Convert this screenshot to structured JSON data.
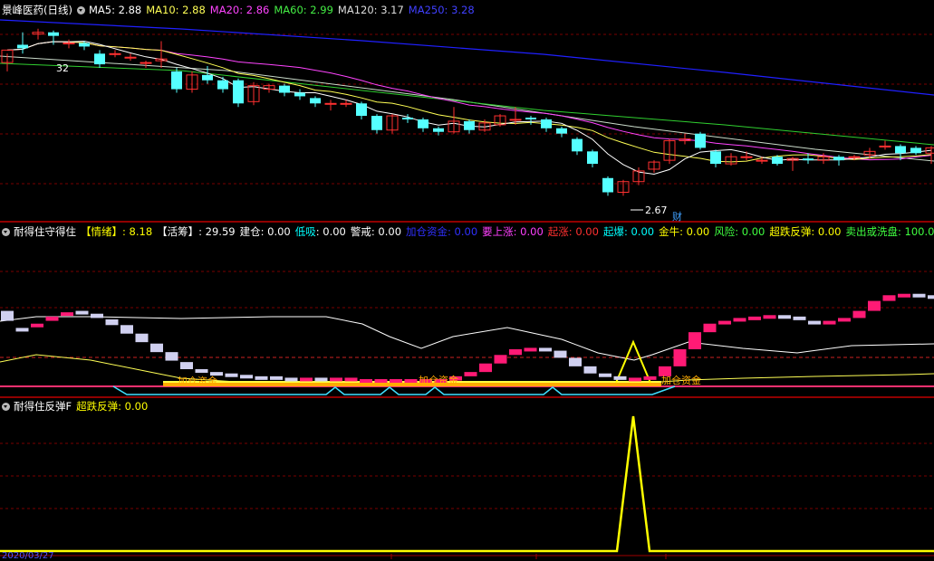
{
  "panel1": {
    "title": "景峰医药(日线)",
    "ma_items": [
      {
        "label": "MA5: 2.88",
        "color": "#ffffff"
      },
      {
        "label": "MA10: 2.88",
        "color": "#ffff55"
      },
      {
        "label": "MA20: 2.86",
        "color": "#ff44ff"
      },
      {
        "label": "MA60: 2.99",
        "color": "#44ee44"
      },
      {
        "label": "MA120: 3.17",
        "color": "#dddddd"
      },
      {
        "label": "MA250: 3.28",
        "color": "#4040ff"
      }
    ],
    "annotations": {
      "high": "32",
      "low": "2.67",
      "event": "财"
    }
  },
  "panel2": {
    "title": "耐得住守得住",
    "items": [
      {
        "label": "【情绪】",
        "value": ": 8.18",
        "color": "#ffff00"
      },
      {
        "label": "【活筹】",
        "value": ": 29.59",
        "color": "#ffffff"
      },
      {
        "label": "建仓",
        "value": ": 0.00",
        "color": "#ffffff"
      },
      {
        "label": "低吸",
        "value": ": 0.00",
        "color": "#00ffff"
      },
      {
        "label": "警戒",
        "value": ": 0.00",
        "color": "#ffffff"
      },
      {
        "label": "加仓资金",
        "value": ": 0.00",
        "color": "#3030ff"
      },
      {
        "label": "要上涨",
        "value": ": 0.00",
        "color": "#ff40ff"
      },
      {
        "label": "起涨",
        "value": ": 0.00",
        "color": "#ff3030"
      },
      {
        "label": "起爆",
        "value": ": 0.00",
        "color": "#00ffff"
      },
      {
        "label": "金牛",
        "value": ": 0.00",
        "color": "#ffff00"
      },
      {
        "label": "风险",
        "value": ": 0.00",
        "color": "#40ff40"
      },
      {
        "label": "超跌反弹",
        "value": ": 0.00",
        "color": "#ffff00"
      },
      {
        "label": "卖出或洗盘",
        "value": ": 100.00",
        "color": "#40ff40"
      }
    ],
    "band_labels": [
      "加仓资金",
      "加仓资金",
      "加仓资金"
    ]
  },
  "panel3": {
    "title": "耐得住反弹F",
    "items": [
      {
        "label": "超跌反弹",
        "value": ": 0.00",
        "color": "#ffff00"
      }
    ],
    "date_label": "2020/03/27"
  },
  "chart_data": [
    {
      "type": "candlestick",
      "title": "景峰医药(日线)",
      "candles": [
        [
          2.95,
          3.02,
          2.9,
          3.0
        ],
        [
          3.05,
          3.03,
          3.0,
          3.12
        ],
        [
          3.11,
          3.12,
          3.08,
          3.14
        ],
        [
          3.12,
          3.1,
          3.05,
          3.13
        ],
        [
          3.06,
          3.06,
          3.03,
          3.08
        ],
        [
          3.06,
          3.04,
          3.02,
          3.07
        ],
        [
          3.0,
          2.94,
          2.92,
          3.02
        ],
        [
          3.0,
          3.0,
          2.98,
          3.02
        ],
        [
          2.98,
          2.98,
          2.96,
          3.0
        ],
        [
          2.95,
          2.95,
          2.92,
          2.96
        ],
        [
          2.96,
          2.97,
          2.92,
          3.07
        ],
        [
          2.9,
          2.8,
          2.78,
          2.92
        ],
        [
          2.8,
          2.88,
          2.78,
          2.9
        ],
        [
          2.88,
          2.85,
          2.83,
          2.93
        ],
        [
          2.85,
          2.8,
          2.78,
          2.87
        ],
        [
          2.85,
          2.72,
          2.7,
          2.86
        ],
        [
          2.73,
          2.82,
          2.71,
          2.84
        ],
        [
          2.8,
          2.82,
          2.78,
          2.83
        ],
        [
          2.82,
          2.78,
          2.76,
          2.83
        ],
        [
          2.78,
          2.76,
          2.74,
          2.8
        ],
        [
          2.75,
          2.72,
          2.7,
          2.76
        ],
        [
          2.72,
          2.72,
          2.68,
          2.74
        ],
        [
          2.72,
          2.72,
          2.7,
          2.74
        ],
        [
          2.72,
          2.65,
          2.63,
          2.73
        ],
        [
          2.65,
          2.57,
          2.55,
          2.66
        ],
        [
          2.57,
          2.65,
          2.55,
          2.66
        ],
        [
          2.64,
          2.63,
          2.61,
          2.66
        ],
        [
          2.63,
          2.58,
          2.56,
          2.64
        ],
        [
          2.58,
          2.56,
          2.54,
          2.59
        ],
        [
          2.56,
          2.62,
          2.55,
          2.7
        ],
        [
          2.62,
          2.57,
          2.55,
          2.63
        ],
        [
          2.57,
          2.61,
          2.56,
          2.63
        ],
        [
          2.6,
          2.65,
          2.59,
          2.66
        ],
        [
          2.63,
          2.63,
          2.6,
          2.7
        ],
        [
          2.64,
          2.63,
          2.6,
          2.65
        ],
        [
          2.63,
          2.58,
          2.56,
          2.64
        ],
        [
          2.58,
          2.55,
          2.53,
          2.59
        ],
        [
          2.52,
          2.45,
          2.43,
          2.53
        ],
        [
          2.45,
          2.38,
          2.36,
          2.46
        ],
        [
          2.3,
          2.22,
          2.2,
          2.31
        ],
        [
          2.22,
          2.28,
          2.2,
          2.29
        ],
        [
          2.28,
          2.34,
          2.26,
          2.36
        ],
        [
          2.35,
          2.39,
          2.33,
          2.4
        ],
        [
          2.4,
          2.51,
          2.38,
          2.52
        ],
        [
          2.51,
          2.52,
          2.49,
          2.55
        ],
        [
          2.55,
          2.47,
          2.46,
          2.56
        ],
        [
          2.45,
          2.38,
          2.36,
          2.46
        ],
        [
          2.38,
          2.42,
          2.37,
          2.44
        ],
        [
          2.42,
          2.42,
          2.4,
          2.45
        ],
        [
          2.4,
          2.4,
          2.38,
          2.42
        ],
        [
          2.42,
          2.38,
          2.37,
          2.43
        ],
        [
          2.4,
          2.41,
          2.34,
          2.42
        ],
        [
          2.41,
          2.4,
          2.38,
          2.44
        ],
        [
          2.4,
          2.42,
          2.38,
          2.44
        ],
        [
          2.42,
          2.4,
          2.37,
          2.43
        ],
        [
          2.42,
          2.42,
          2.4,
          2.43
        ],
        [
          2.43,
          2.45,
          2.41,
          2.47
        ],
        [
          2.48,
          2.48,
          2.46,
          2.51
        ],
        [
          2.48,
          2.44,
          2.4,
          2.49
        ],
        [
          2.47,
          2.44,
          2.43,
          2.48
        ],
        [
          2.44,
          2.47,
          2.38,
          2.48
        ]
      ]
    },
    {
      "type": "bar",
      "title": "耐得住守得住",
      "bars": [
        [
          55,
          48
        ],
        [
          43,
          42
        ],
        [
          44,
          46
        ],
        [
          48,
          51
        ],
        [
          52,
          54
        ],
        [
          55,
          54
        ],
        [
          53,
          50
        ],
        [
          49,
          45
        ],
        [
          45,
          39
        ],
        [
          39,
          33
        ],
        [
          32,
          26
        ],
        [
          26,
          20
        ],
        [
          19,
          14
        ],
        [
          14,
          12
        ],
        [
          12,
          10
        ],
        [
          11,
          9
        ],
        [
          10,
          9
        ],
        [
          9,
          8
        ],
        [
          9,
          8
        ],
        [
          8,
          7
        ],
        [
          8,
          8
        ],
        [
          8,
          7
        ],
        [
          8,
          8
        ],
        [
          8,
          8
        ],
        [
          7,
          7
        ],
        [
          7,
          7
        ],
        [
          7,
          7
        ],
        [
          7,
          7
        ],
        [
          7,
          7
        ],
        [
          7,
          7
        ],
        [
          6,
          9
        ],
        [
          9,
          12
        ],
        [
          12,
          18
        ],
        [
          18,
          24
        ],
        [
          24,
          28
        ],
        [
          28,
          29
        ],
        [
          29,
          27
        ],
        [
          27,
          22
        ],
        [
          22,
          16
        ],
        [
          16,
          11
        ],
        [
          11,
          9
        ],
        [
          9,
          7
        ],
        [
          7,
          8
        ],
        [
          8,
          9
        ],
        [
          9,
          16
        ],
        [
          16,
          28
        ],
        [
          28,
          40
        ],
        [
          40,
          46
        ],
        [
          46,
          48
        ],
        [
          48,
          50
        ],
        [
          50,
          51
        ],
        [
          51,
          52
        ],
        [
          52,
          51
        ],
        [
          51,
          49
        ],
        [
          48,
          47
        ],
        [
          47,
          48
        ],
        [
          48,
          50
        ],
        [
          50,
          55
        ],
        [
          55,
          62
        ],
        [
          62,
          66
        ],
        [
          66,
          67
        ],
        [
          67,
          66
        ],
        [
          66,
          64
        ]
      ],
      "rising_color": "#ff1a75",
      "falling_color": "#d0d0f0"
    },
    {
      "type": "line",
      "title": "耐得住反弹F",
      "series": [
        {
          "name": "超跌反弹",
          "values": [
            0,
            0,
            0,
            0,
            0,
            0,
            0,
            0,
            0,
            0,
            0,
            0,
            0,
            0,
            0,
            0,
            0,
            0,
            0,
            0,
            0,
            0,
            0,
            0,
            0,
            0,
            0,
            0,
            0,
            0,
            0,
            0,
            0,
            0,
            0,
            0,
            0,
            0,
            0,
            0,
            0,
            0,
            0,
            0,
            0,
            0,
            0,
            0,
            0,
            0,
            0,
            0,
            0,
            0,
            0,
            0,
            100,
            0,
            0,
            0,
            0,
            0,
            0,
            0,
            0,
            0,
            0,
            0,
            0,
            0,
            0,
            0,
            0,
            0,
            0,
            0,
            0,
            0,
            0,
            0,
            0,
            0,
            0,
            0
          ]
        }
      ]
    }
  ]
}
